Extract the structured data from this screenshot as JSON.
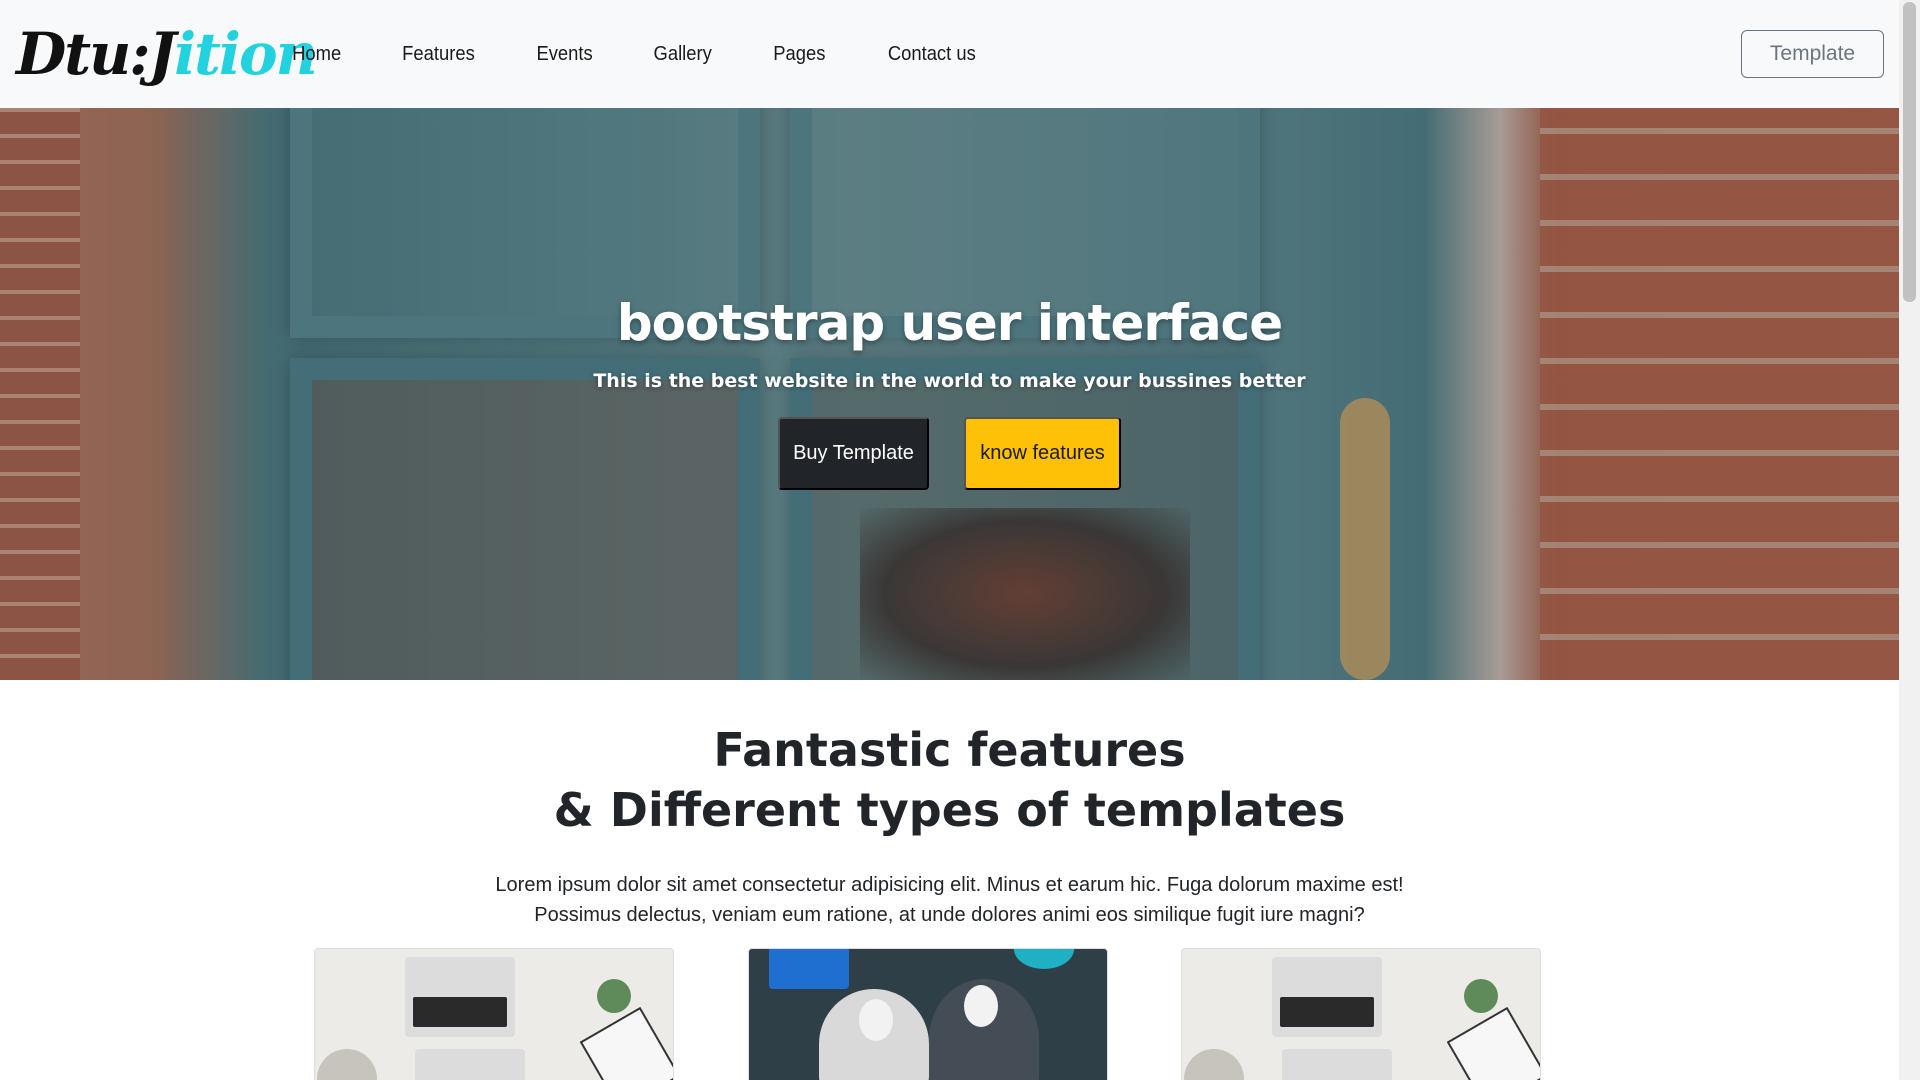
{
  "navbar": {
    "brand_part1": "Dtu:J",
    "brand_part2": "ition",
    "links": [
      "Home",
      "Features",
      "Events",
      "Gallery",
      "Pages",
      "Contact us"
    ],
    "template_button": "Template"
  },
  "hero": {
    "title": "bootstrap user interface",
    "subtitle": "This is the best website in the world to make your bussines better",
    "buy_button": "Buy Template",
    "features_button": "know features"
  },
  "features": {
    "title_line1": "Fantastic features",
    "title_line2": "& Different types of templates",
    "text_line1": "Lorem ipsum dolor sit amet consectetur adipisicing elit. Minus et earum hic. Fuga dolorum maxime est!",
    "text_line2": "Possimus delectus, veniam eum ratione, at unde dolores animi eos similique fugit iure magni?"
  },
  "colors": {
    "accent_cyan": "#22d3df",
    "warning_yellow": "#ffc107",
    "dark_button": "#212529",
    "navbar_bg": "#f8f9fa"
  }
}
